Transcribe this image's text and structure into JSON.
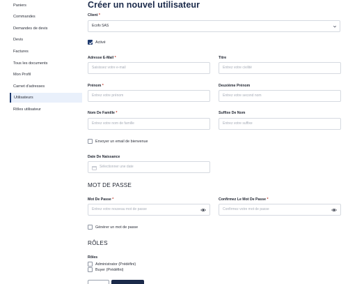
{
  "sidebar": {
    "items": [
      {
        "label": "Paniers",
        "active": false
      },
      {
        "label": "Commandes",
        "active": false
      },
      {
        "label": "Demandes de devis",
        "active": false
      },
      {
        "label": "Devis",
        "active": false
      },
      {
        "label": "Factures",
        "active": false
      },
      {
        "label": "Tous les documents",
        "active": false
      },
      {
        "label": "Mon Profil",
        "active": false
      },
      {
        "label": "Carnet d'adresses",
        "active": false
      },
      {
        "label": "Utilisateurs",
        "active": true
      },
      {
        "label": "Rôles utilisateur",
        "active": false
      }
    ]
  },
  "page": {
    "title": "Créer un nouvel utilisateur"
  },
  "form": {
    "client": {
      "label": "Client",
      "value": "Ecofo SAS"
    },
    "active": {
      "label": "Activé",
      "checked": true
    },
    "email": {
      "label": "Adresse E-Mail",
      "placeholder": "Saisissez votre e-mail"
    },
    "titre": {
      "label": "Titre",
      "placeholder": "Entrez votre civilité"
    },
    "prenom": {
      "label": "Prénom",
      "placeholder": "Entrez votre prénom"
    },
    "deuxieme_prenom": {
      "label": "Deuxième Prénom",
      "placeholder": "Entrez votre second nom"
    },
    "nom": {
      "label": "Nom De Famille",
      "placeholder": "Entrez votre nom de famille"
    },
    "suffixe": {
      "label": "Suffixe De Nom",
      "placeholder": "Entrez votre suffixe"
    },
    "welcome_email": {
      "label": "Envoyer un email de bienvenue",
      "checked": false
    },
    "naissance": {
      "label": "Date De Naissance",
      "placeholder": "Sélectionner une date"
    },
    "required_mark": "*"
  },
  "password_section": {
    "title": "MOT DE PASSE",
    "password": {
      "label": "Mot De Passe",
      "placeholder": "Entrez votre nouveau mot de passe"
    },
    "confirm": {
      "label": "Confirmez Le Mot De Passe",
      "placeholder": "Confirmez votre mot de passe"
    },
    "generate": {
      "label": "Générer un mot de passe",
      "checked": false
    }
  },
  "roles_section": {
    "title": "RÔLES",
    "label": "Rôles",
    "roles": [
      {
        "label": "Administrator (Prédéfini)",
        "checked": false
      },
      {
        "label": "Buyer (Prédéfini)",
        "checked": false
      }
    ]
  },
  "colors": {
    "primary": "#1b2a4a",
    "active_bg": "#e9f0fb",
    "required": "#c0392b"
  }
}
